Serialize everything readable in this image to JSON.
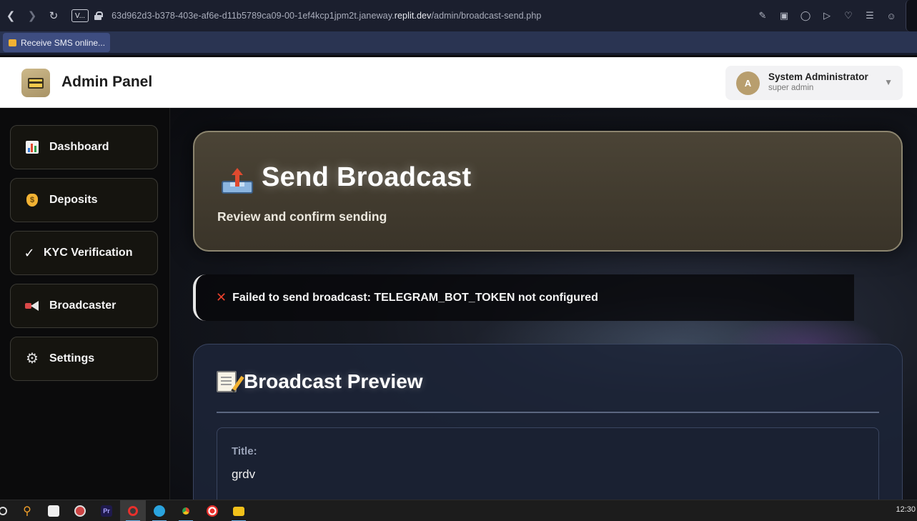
{
  "browser": {
    "tab_badge": "V...",
    "url_prefix": "63d962d3-b378-403e-af6e-d11b5789ca09-00-1ef4kcp1jpm2t.janeway.",
    "url_host": "replit.dev",
    "url_path": "/admin/broadcast-send.php",
    "bookmark": "Receive SMS online..."
  },
  "header": {
    "app_title": "Admin Panel",
    "user_initial": "A",
    "user_name": "System Administrator",
    "user_role": "super admin"
  },
  "sidebar": {
    "items": [
      {
        "label": "Dashboard",
        "icon": "bar-chart-icon"
      },
      {
        "label": "Deposits",
        "icon": "money-bag-icon"
      },
      {
        "label": "KYC Verification",
        "icon": "checkmark-icon"
      },
      {
        "label": "Broadcaster",
        "icon": "megaphone-icon"
      },
      {
        "label": "Settings",
        "icon": "gear-icon"
      }
    ]
  },
  "main": {
    "hero_title": "Send Broadcast",
    "hero_subtitle": "Review and confirm sending",
    "alert_text": "Failed to send broadcast: TELEGRAM_BOT_TOKEN not configured",
    "preview_title": "Broadcast Preview",
    "field_label": "Title:",
    "field_value": "grdv"
  },
  "taskbar": {
    "clock": "12:30"
  },
  "colors": {
    "accent_gold": "#b89e6e",
    "error_red": "#e8402c",
    "sidebar_bg": "#0b0b0c",
    "preview_bg": "#1c2438"
  }
}
